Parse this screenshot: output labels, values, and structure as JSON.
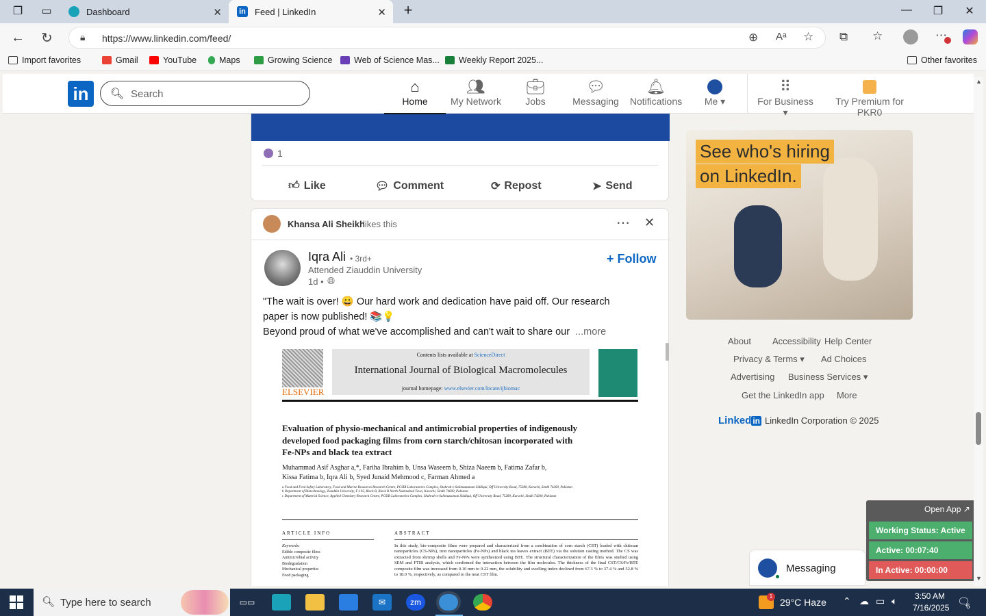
{
  "browser": {
    "tabs": [
      {
        "title": "Dashboard"
      },
      {
        "title": "Feed | LinkedIn"
      }
    ],
    "url": "https://www.linkedin.com/feed/",
    "favorites": [
      {
        "label": "Import favorites"
      },
      {
        "label": "Gmail"
      },
      {
        "label": "YouTube"
      },
      {
        "label": "Maps"
      },
      {
        "label": "Growing Science"
      },
      {
        "label": "Web of Science Mas..."
      },
      {
        "label": "Weekly Report 2025..."
      }
    ],
    "other_favorites": "Other favorites"
  },
  "linkedin": {
    "search_placeholder": "Search",
    "nav": [
      {
        "label": "Home",
        "icon": "home-icon",
        "active": true
      },
      {
        "label": "My Network",
        "icon": "network-icon"
      },
      {
        "label": "Jobs",
        "icon": "briefcase-icon"
      },
      {
        "label": "Messaging",
        "icon": "chat-icon"
      },
      {
        "label": "Notifications",
        "icon": "bell-icon"
      },
      {
        "label": "Me",
        "icon": "avatar-icon"
      },
      {
        "label": "For Business",
        "icon": "grid-icon"
      },
      {
        "label": "Try Premium for PKR0",
        "icon": "premium-icon"
      }
    ]
  },
  "post1": {
    "reactions": "1",
    "actions": [
      "Like",
      "Comment",
      "Repost",
      "Send"
    ]
  },
  "post2": {
    "liker": "Khansa Ali Sheikh",
    "liker_suffix": "likes this",
    "author": "Iqra Ali",
    "degree": "• 3rd+",
    "headline": "Attended Ziauddin University",
    "time": "1d •",
    "follow": "+ Follow",
    "text_line1": "\"The wait is over! 😀 Our hard work and dedication have paid off. Our research",
    "text_line2": "paper is now published! 📚💡",
    "text_line3": "Beyond proud of what we've accomplished and can't wait to share our",
    "more": "...more"
  },
  "paper": {
    "contents": "Contents lists available at",
    "sciencedirect": "ScienceDirect",
    "journal": "International Journal of Biological Macromolecules",
    "homepage_label": "journal homepage:",
    "homepage_url": "www.elsevier.com/locate/ijbiomac",
    "publisher": "ELSEVIER",
    "title": "Evaluation of physio-mechanical and antimicrobial properties of indigenously developed food packaging films from corn starch/chitosan incorporated with Fe-NPs and black tea extract",
    "authors_line1": "Muhammad Asif Asghar a,*, Fariha Ibrahim b, Unsa Waseem b, Shiza Naeem b, Fatima Zafar b,",
    "authors_line2": "Kissa Fatima b, Iqra Ali b, Syed Junaid Mehmood c, Farman Ahmed a",
    "affil_a": "a Food and Feed Safety Laboratory, Food and Marine Resources Research Centre, PCSIR Laboratories Complex, Shahrah-e-Salimuzzaman Siddiqui, Off University Road, 75280, Karachi, Sindh 74200, Pakistan",
    "affil_b": "b Department of Biotechnology, Ziauddin University, F-103, Block B, Block B North Nazimabad Town, Karachi, Sindh 74600, Pakistan",
    "affil_c": "c Department of Material Science, Applied Chemistry Research Centre, PCSIR Laboratories Complex, Shahrah-e-Salimuzzaman Siddiqui, Off University Road, 75280, Karachi, Sindh 74200, Pakistan",
    "article_info": "ARTICLE INFO",
    "abstract_label": "ABSTRACT",
    "keywords_label": "Keywords:",
    "keywords": [
      "Edible composite films",
      "Antimicrobial activity",
      "Biodegradation",
      "Mechanical properties",
      "Food packaging"
    ],
    "abstract_text": "In this study, bio-composite films were prepared and characterized from a combination of corn starch (CST) loaded with chitosan nanoparticles (CS-NPs), iron nanoparticles (Fe-NPs) and black tea leaves extract (BTE) via the solution casting method. The CS was extracted from shrimp shells and Fe-NPs were synthesized using BTE. The structural characterization of the films was studied using SEM and FTIR analysis, which confirmed the interaction between the film molecules. The thickness of the final CST/CS/Fe/BTE composite film was increased from 0.10 mm to 0.22 mm, the solubility and swelling index declined from 67.3 % to 37.4 % and 52.8 % to 18.0 %, respectively, as compared to the neat CST film."
  },
  "ad": {
    "line1": "See who's hiring",
    "line2": "on LinkedIn."
  },
  "footer": {
    "links": [
      "About",
      "Accessibility",
      "Help Center",
      "Privacy & Terms",
      "Ad Choices",
      "Advertising",
      "Business Services",
      "Get the LinkedIn app",
      "More"
    ],
    "brand": "Linked",
    "brand_in": "in",
    "copyright": "LinkedIn Corporation © 2025"
  },
  "messaging_bar": "Messaging",
  "widget": {
    "open_app": "Open App ↗",
    "status": "Working Status: Active",
    "active": "Active: 00:07:40",
    "inactive": "In Active: 00:00:00"
  },
  "taskbar": {
    "search_placeholder": "Type here to search",
    "weather": "29°C  Haze",
    "weather_badge": "1",
    "time": "3:50 AM",
    "date": "7/16/2025",
    "notif_count": "6"
  },
  "colors": {
    "linkedin_blue": "#0a66c2",
    "taskbar": "#1c2e48",
    "widget_green": "#4caf6e",
    "widget_red": "#e05a5a"
  }
}
